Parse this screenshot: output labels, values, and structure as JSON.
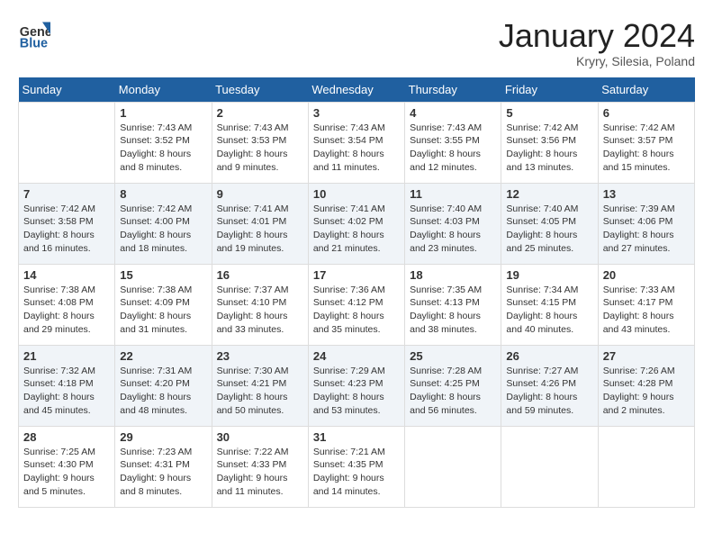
{
  "header": {
    "logo_general": "General",
    "logo_blue": "Blue",
    "month_title": "January 2024",
    "location": "Kryry, Silesia, Poland"
  },
  "days_of_week": [
    "Sunday",
    "Monday",
    "Tuesday",
    "Wednesday",
    "Thursday",
    "Friday",
    "Saturday"
  ],
  "weeks": [
    [
      {
        "day": "",
        "info": ""
      },
      {
        "day": "1",
        "info": "Sunrise: 7:43 AM\nSunset: 3:52 PM\nDaylight: 8 hours and 8 minutes."
      },
      {
        "day": "2",
        "info": "Sunrise: 7:43 AM\nSunset: 3:53 PM\nDaylight: 8 hours and 9 minutes."
      },
      {
        "day": "3",
        "info": "Sunrise: 7:43 AM\nSunset: 3:54 PM\nDaylight: 8 hours and 11 minutes."
      },
      {
        "day": "4",
        "info": "Sunrise: 7:43 AM\nSunset: 3:55 PM\nDaylight: 8 hours and 12 minutes."
      },
      {
        "day": "5",
        "info": "Sunrise: 7:42 AM\nSunset: 3:56 PM\nDaylight: 8 hours and 13 minutes."
      },
      {
        "day": "6",
        "info": "Sunrise: 7:42 AM\nSunset: 3:57 PM\nDaylight: 8 hours and 15 minutes."
      }
    ],
    [
      {
        "day": "7",
        "info": "Sunrise: 7:42 AM\nSunset: 3:58 PM\nDaylight: 8 hours and 16 minutes."
      },
      {
        "day": "8",
        "info": "Sunrise: 7:42 AM\nSunset: 4:00 PM\nDaylight: 8 hours and 18 minutes."
      },
      {
        "day": "9",
        "info": "Sunrise: 7:41 AM\nSunset: 4:01 PM\nDaylight: 8 hours and 19 minutes."
      },
      {
        "day": "10",
        "info": "Sunrise: 7:41 AM\nSunset: 4:02 PM\nDaylight: 8 hours and 21 minutes."
      },
      {
        "day": "11",
        "info": "Sunrise: 7:40 AM\nSunset: 4:03 PM\nDaylight: 8 hours and 23 minutes."
      },
      {
        "day": "12",
        "info": "Sunrise: 7:40 AM\nSunset: 4:05 PM\nDaylight: 8 hours and 25 minutes."
      },
      {
        "day": "13",
        "info": "Sunrise: 7:39 AM\nSunset: 4:06 PM\nDaylight: 8 hours and 27 minutes."
      }
    ],
    [
      {
        "day": "14",
        "info": "Sunrise: 7:38 AM\nSunset: 4:08 PM\nDaylight: 8 hours and 29 minutes."
      },
      {
        "day": "15",
        "info": "Sunrise: 7:38 AM\nSunset: 4:09 PM\nDaylight: 8 hours and 31 minutes."
      },
      {
        "day": "16",
        "info": "Sunrise: 7:37 AM\nSunset: 4:10 PM\nDaylight: 8 hours and 33 minutes."
      },
      {
        "day": "17",
        "info": "Sunrise: 7:36 AM\nSunset: 4:12 PM\nDaylight: 8 hours and 35 minutes."
      },
      {
        "day": "18",
        "info": "Sunrise: 7:35 AM\nSunset: 4:13 PM\nDaylight: 8 hours and 38 minutes."
      },
      {
        "day": "19",
        "info": "Sunrise: 7:34 AM\nSunset: 4:15 PM\nDaylight: 8 hours and 40 minutes."
      },
      {
        "day": "20",
        "info": "Sunrise: 7:33 AM\nSunset: 4:17 PM\nDaylight: 8 hours and 43 minutes."
      }
    ],
    [
      {
        "day": "21",
        "info": "Sunrise: 7:32 AM\nSunset: 4:18 PM\nDaylight: 8 hours and 45 minutes."
      },
      {
        "day": "22",
        "info": "Sunrise: 7:31 AM\nSunset: 4:20 PM\nDaylight: 8 hours and 48 minutes."
      },
      {
        "day": "23",
        "info": "Sunrise: 7:30 AM\nSunset: 4:21 PM\nDaylight: 8 hours and 50 minutes."
      },
      {
        "day": "24",
        "info": "Sunrise: 7:29 AM\nSunset: 4:23 PM\nDaylight: 8 hours and 53 minutes."
      },
      {
        "day": "25",
        "info": "Sunrise: 7:28 AM\nSunset: 4:25 PM\nDaylight: 8 hours and 56 minutes."
      },
      {
        "day": "26",
        "info": "Sunrise: 7:27 AM\nSunset: 4:26 PM\nDaylight: 8 hours and 59 minutes."
      },
      {
        "day": "27",
        "info": "Sunrise: 7:26 AM\nSunset: 4:28 PM\nDaylight: 9 hours and 2 minutes."
      }
    ],
    [
      {
        "day": "28",
        "info": "Sunrise: 7:25 AM\nSunset: 4:30 PM\nDaylight: 9 hours and 5 minutes."
      },
      {
        "day": "29",
        "info": "Sunrise: 7:23 AM\nSunset: 4:31 PM\nDaylight: 9 hours and 8 minutes."
      },
      {
        "day": "30",
        "info": "Sunrise: 7:22 AM\nSunset: 4:33 PM\nDaylight: 9 hours and 11 minutes."
      },
      {
        "day": "31",
        "info": "Sunrise: 7:21 AM\nSunset: 4:35 PM\nDaylight: 9 hours and 14 minutes."
      },
      {
        "day": "",
        "info": ""
      },
      {
        "day": "",
        "info": ""
      },
      {
        "day": "",
        "info": ""
      }
    ]
  ]
}
